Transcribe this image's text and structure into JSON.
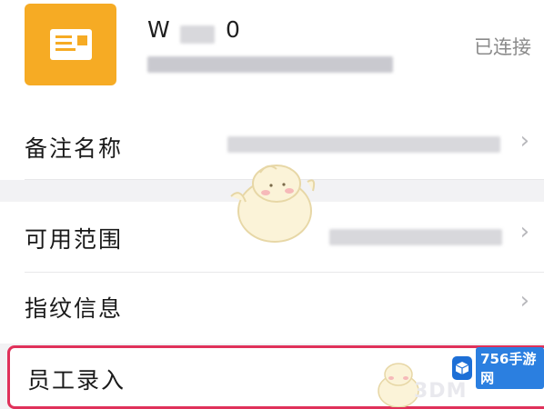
{
  "device": {
    "name": "W",
    "name_suffix": "0",
    "status": "已连接",
    "icon": "id-card-icon"
  },
  "rows": [
    {
      "label": "备注名称",
      "chevron": "›"
    },
    {
      "label": "可用范围",
      "chevron": "›"
    },
    {
      "label": "指纹信息",
      "chevron": "›"
    },
    {
      "label": "员工录入"
    }
  ],
  "watermark": {
    "brand": "756手游网",
    "ghost": "3DM"
  },
  "colors": {
    "accent": "#f6ab24",
    "highlight": "#e0315a",
    "status_text": "#8a8a8a"
  }
}
